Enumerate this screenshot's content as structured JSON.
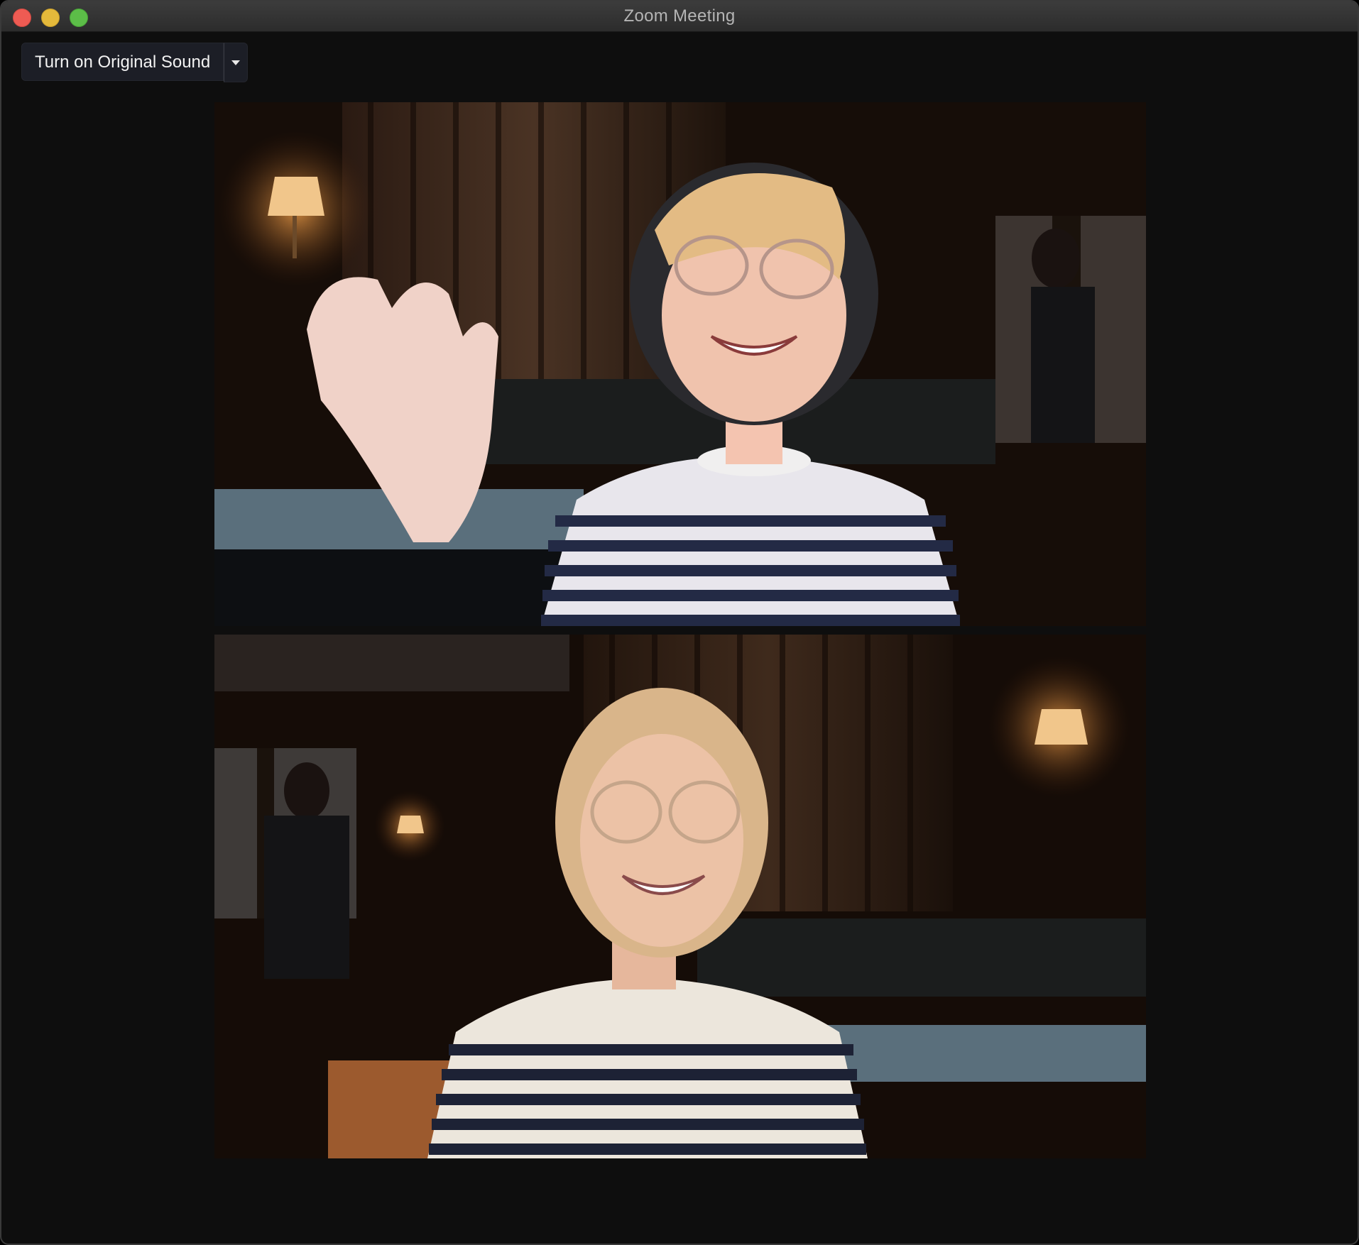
{
  "window": {
    "title": "Zoom Meeting"
  },
  "toolbar": {
    "original_sound_label": "Turn on Original Sound",
    "dropdown_icon": "chevron-down-icon"
  },
  "videos": [
    {
      "id": "participant-1",
      "description_icon": "video-feed"
    },
    {
      "id": "participant-2",
      "description_icon": "video-feed"
    }
  ],
  "colors": {
    "background": "#0e0e0e",
    "titlebar": "#333333",
    "button": "#1c1e26",
    "close": "#ee5b53",
    "minimize": "#e4b93b",
    "zoom": "#5cbd48"
  }
}
